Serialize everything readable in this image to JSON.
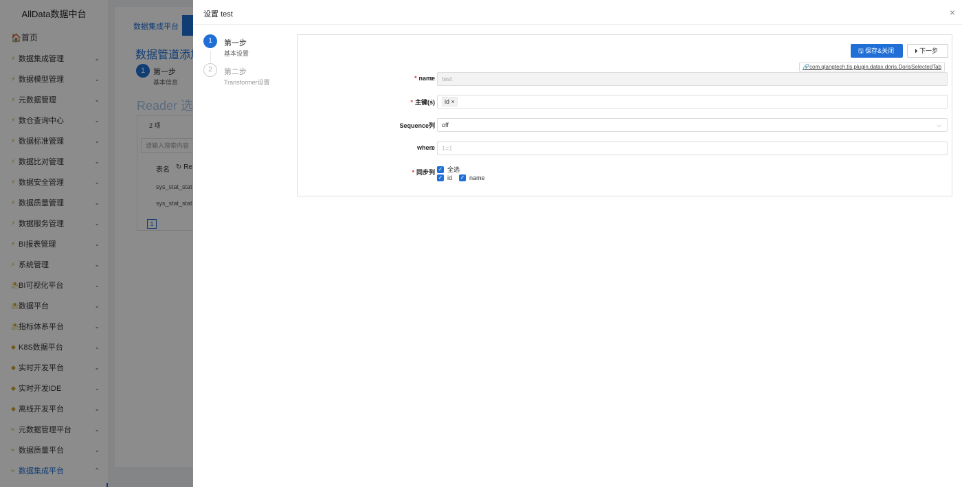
{
  "sidebar": {
    "logo": "AllData数据中台",
    "home": "🏠首页",
    "items": [
      {
        "label": "数据集成管理",
        "icon": "⚡"
      },
      {
        "label": "数据模型管理",
        "icon": "⚡"
      },
      {
        "label": "元数据管理",
        "icon": "⚡"
      },
      {
        "label": "数仓查询中心",
        "icon": "⚡"
      },
      {
        "label": "数据标准管理",
        "icon": "⚡"
      },
      {
        "label": "数据比对管理",
        "icon": "⚡"
      },
      {
        "label": "数据安全管理",
        "icon": "⚡"
      },
      {
        "label": "数据质量管理",
        "icon": "⚡"
      },
      {
        "label": "数据服务管理",
        "icon": "⚡"
      },
      {
        "label": "BI报表管理",
        "icon": "⚡"
      },
      {
        "label": "系统管理",
        "icon": "⚡"
      },
      {
        "label": "BI可视化平台",
        "icon": "⛱"
      },
      {
        "label": "数据平台",
        "icon": "⛱"
      },
      {
        "label": "指标体系平台",
        "icon": "⛱"
      },
      {
        "label": "K8S数据平台",
        "icon": "◆"
      },
      {
        "label": "实时开发平台",
        "icon": "◆"
      },
      {
        "label": "实时开发IDE",
        "icon": "◆"
      },
      {
        "label": "离线开发平台",
        "icon": "◆"
      },
      {
        "label": "元数据管理平台",
        "icon": "≈"
      },
      {
        "label": "数据质量平台",
        "icon": "≈"
      },
      {
        "label": "数据集成平台",
        "icon": "≈"
      }
    ]
  },
  "background": {
    "tab": "数据集成平台",
    "title": "数据管道添加",
    "step_number": "1",
    "step_title": "第一步",
    "step_sub": "基本信息",
    "reader_title": "Reader 选",
    "count": "2 项",
    "search_placeholder": "请输入搜索内容",
    "col_name": "表名",
    "refresh": "Re",
    "rows": [
      "sys_stat_stat",
      "sys_stat_stat"
    ],
    "page": "1"
  },
  "drawer": {
    "title": "设置 test",
    "close": "×",
    "steps": [
      {
        "number": "1",
        "title": "第一步",
        "sub": "基本设置"
      },
      {
        "number": "2",
        "title": "第二步",
        "sub": "Transformer设置"
      }
    ],
    "save_close": "保存&关闭",
    "next": "下一步",
    "plugin_link": "com.qlangtech.tis.plugin.datax.doris.DorisSelectedTab",
    "fields": {
      "name_label": "name",
      "name_value": "test",
      "pk_label": "主键(s)",
      "pk_tag": "id",
      "seq_label": "Sequence列",
      "seq_value": "off",
      "where_label": "where",
      "where_placeholder": "1=1",
      "sync_label": "同步列",
      "select_all": "全选",
      "col_id": "id",
      "col_name": "name"
    }
  }
}
